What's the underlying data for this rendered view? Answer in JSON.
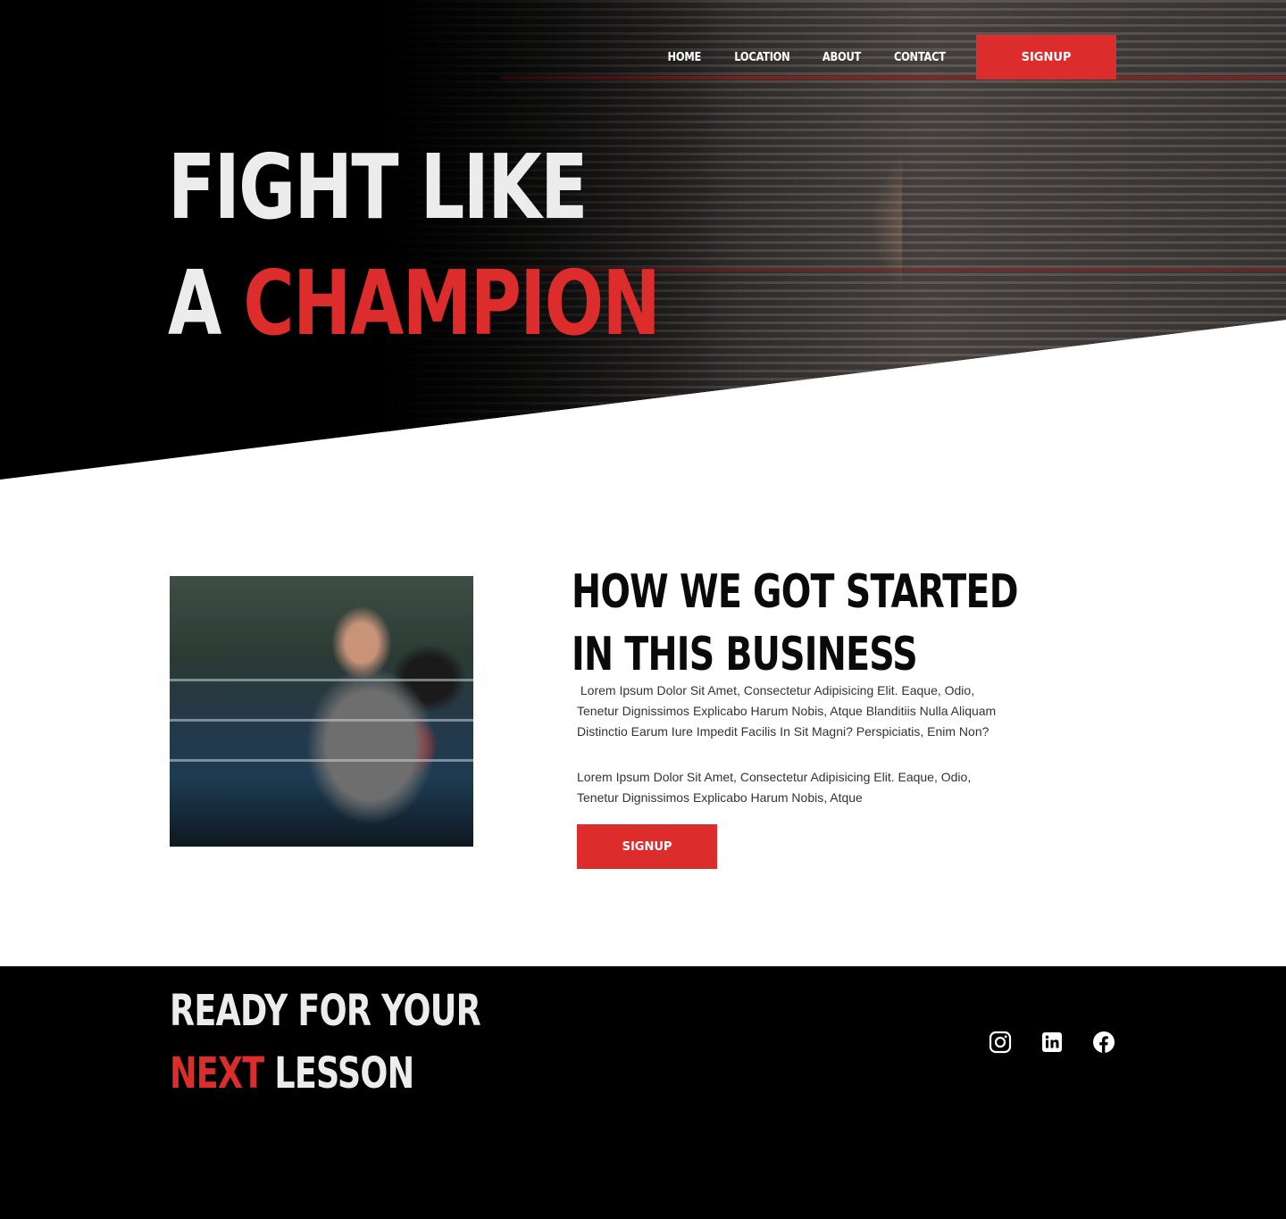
{
  "nav": {
    "links": [
      "HOME",
      "LOCATION",
      "ABOUT",
      "CONTACT"
    ],
    "signup_label": "SIGNUP"
  },
  "hero": {
    "line1": "FIGHT LIKE",
    "line2_prefix": "A",
    "line2_accent": "CHAMPION"
  },
  "about": {
    "title_line1": "HOW WE GOT STARTED",
    "title_line2": "IN THIS BUSINESS",
    "paragraph1": " Lorem Ipsum Dolor Sit Amet, Consectetur Adipisicing Elit. Eaque, Odio, Tenetur Dignissimos Explicabo Harum Nobis, Atque Blanditiis Nulla Aliquam Distinctio Earum Iure Impedit Facilis In Sit Magni? Perspiciatis, Enim Non?",
    "paragraph2": "Lorem Ipsum Dolor Sit Amet, Consectetur Adipisicing Elit. Eaque, Odio, Tenetur Dignissimos Explicabo Harum Nobis, Atque",
    "signup_label": "SIGNUP"
  },
  "footer": {
    "title_line1": "READY FOR YOUR",
    "title_line2_accent": "NEXT",
    "title_line2_rest": "LESSON",
    "socials": [
      "instagram-icon",
      "linkedin-icon",
      "facebook-icon"
    ]
  },
  "colors": {
    "accent": "#dd2c2c",
    "dark": "#000000",
    "light_text": "#ececec"
  }
}
